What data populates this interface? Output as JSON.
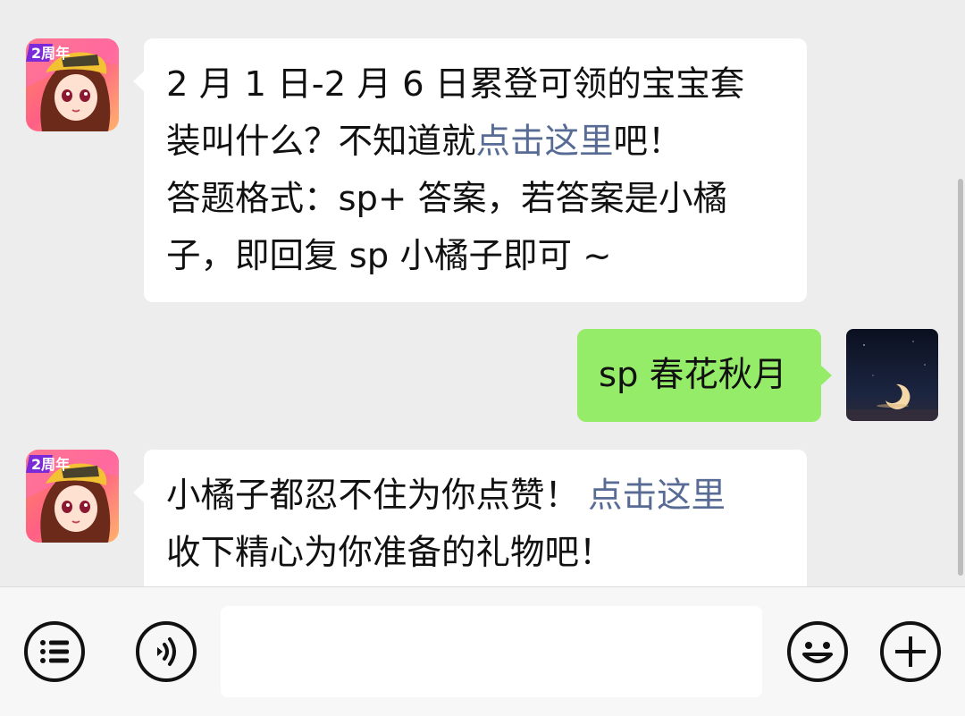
{
  "chat": {
    "messages": [
      {
        "sender": "official",
        "lines": [
          {
            "before": "2 月 1 日-2 月 6 日累登可领的宝宝套",
            "link": "",
            "after": ""
          },
          {
            "before": "装叫什么？不知道就",
            "link": "点击这里",
            "after": "吧！"
          },
          {
            "before": "答题格式：sp+ 答案，若答案是小橘",
            "link": "",
            "after": ""
          },
          {
            "before": "子，即回复 sp 小橘子即可 ~",
            "link": "",
            "after": ""
          }
        ]
      },
      {
        "sender": "me",
        "text": "sp 春花秋月"
      },
      {
        "sender": "official",
        "lines": [
          {
            "before": "小橘子都忍不住为你点赞！",
            "link": "点击这里",
            "after": ""
          },
          {
            "before": "收下精心为你准备的礼物吧！",
            "link": "",
            "after": ""
          }
        ]
      }
    ],
    "avatar_badge_text": "2周年"
  },
  "input_bar": {
    "menu_icon": "list-menu-icon",
    "voice_icon": "voice-icon",
    "input_value": "",
    "emoji_icon": "emoji-icon",
    "plus_icon": "plus-icon"
  },
  "colors": {
    "background": "#ededed",
    "incoming_bubble": "#ffffff",
    "outgoing_bubble": "#95ec69",
    "link": "#576b95",
    "input_bar": "#f7f7f7"
  }
}
